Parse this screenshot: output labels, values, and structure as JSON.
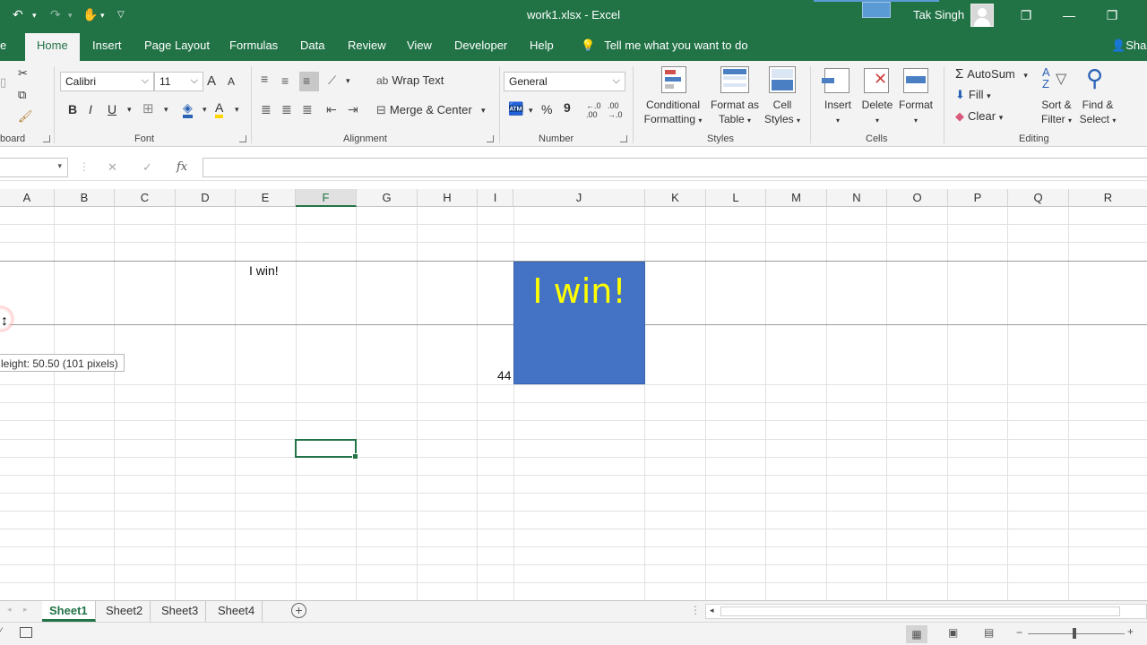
{
  "window": {
    "title": "work1.xlsx  -  Excel",
    "user": "Tak Singh"
  },
  "tabs": [
    {
      "id": "file",
      "label": "e"
    },
    {
      "id": "home",
      "label": "Home"
    },
    {
      "id": "insert",
      "label": "Insert"
    },
    {
      "id": "page_layout",
      "label": "Page Layout"
    },
    {
      "id": "formulas",
      "label": "Formulas"
    },
    {
      "id": "data",
      "label": "Data"
    },
    {
      "id": "review",
      "label": "Review"
    },
    {
      "id": "view",
      "label": "View"
    },
    {
      "id": "developer",
      "label": "Developer"
    },
    {
      "id": "help",
      "label": "Help"
    }
  ],
  "tellme": "Tell me what you want to do",
  "share": "Sha",
  "ribbon": {
    "clipboard_label": "board",
    "font": {
      "name": "Calibri",
      "size": "11",
      "bold": "B",
      "italic": "I",
      "underline": "U",
      "grow": "A",
      "shrink": "A",
      "font_color": "A",
      "label": "Font"
    },
    "alignment": {
      "wrap_text": "Wrap Text",
      "merge_center": "Merge & Center",
      "label": "Alignment"
    },
    "number": {
      "format": "General",
      "percent": "%",
      "comma": "9",
      "inc_decimal": "←.0\n.00",
      "dec_decimal": ".00\n→.0",
      "label": "Number"
    },
    "styles": {
      "conditional_l1": "Conditional",
      "conditional_l2": "Formatting",
      "format_table_l1": "Format as",
      "format_table_l2": "Table",
      "cell_styles_l1": "Cell",
      "cell_styles_l2": "Styles",
      "label": "Styles"
    },
    "cells": {
      "insert": "Insert",
      "delete": "Delete",
      "format": "Format",
      "label": "Cells"
    },
    "editing": {
      "autosum": "AutoSum",
      "fill": "Fill",
      "clear": "Clear",
      "sort_l1": "Sort &",
      "sort_l2": "Filter",
      "find_l1": "Find &",
      "find_l2": "Select",
      "label": "Editing"
    }
  },
  "formula_bar": {
    "cancel": "✕",
    "enter": "✓",
    "fx": "fx",
    "value": ""
  },
  "columns": [
    "A",
    "B",
    "C",
    "D",
    "E",
    "F",
    "G",
    "H",
    "I",
    "J",
    "K",
    "L",
    "M",
    "N",
    "O",
    "P",
    "Q",
    "R"
  ],
  "selected_column": "F",
  "cells": {
    "e2": "I win!",
    "i_bottom": "44"
  },
  "shape_text": "I win!",
  "row_height_tooltip": "leight: 50.50 (101 pixels)",
  "sheets": [
    "Sheet1",
    "Sheet2",
    "Sheet3",
    "Sheet4"
  ],
  "active_sheet": "Sheet1",
  "colors": {
    "excel_green": "#217346",
    "shape_fill": "#4472c4",
    "shape_text": "#ffff00"
  }
}
